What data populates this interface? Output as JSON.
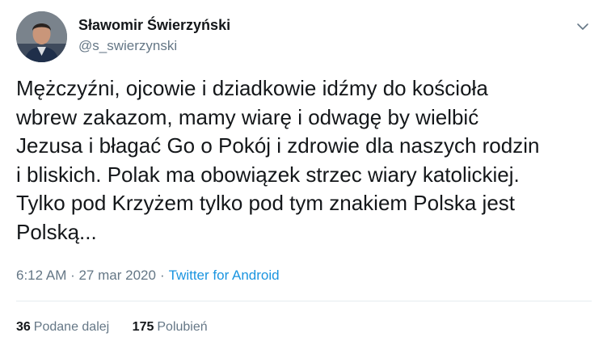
{
  "author": {
    "display_name": "Sławomir Świerzyński",
    "handle": "@s_swierzynski"
  },
  "menu_icon": "chevron-down-icon",
  "tweet": {
    "text": "Mężczyźni, ojcowie i dziadkowie idźmy do kościoła\nwbrew zakazom, mamy wiarę i odwagę by wielbić\nJezusa i błagać Go o Pokój i zdrowie dla naszych rodzin\ni bliskich. Polak ma obowiązek strzec wiary katolickiej.\nTylko pod  Krzyżem tylko pod tym znakiem Polska jest\nPolską...",
    "timestamp": "6:12 AM · 27 mar 2020",
    "separator": "·",
    "source": "Twitter for Android"
  },
  "stats": {
    "retweets_count": "36",
    "retweets_label": "Podane dalej",
    "likes_count": "175",
    "likes_label": "Polubień"
  },
  "colors": {
    "text": "#14171a",
    "secondary": "#657786",
    "link": "#1b95e0",
    "divider": "#e6ecf0"
  }
}
